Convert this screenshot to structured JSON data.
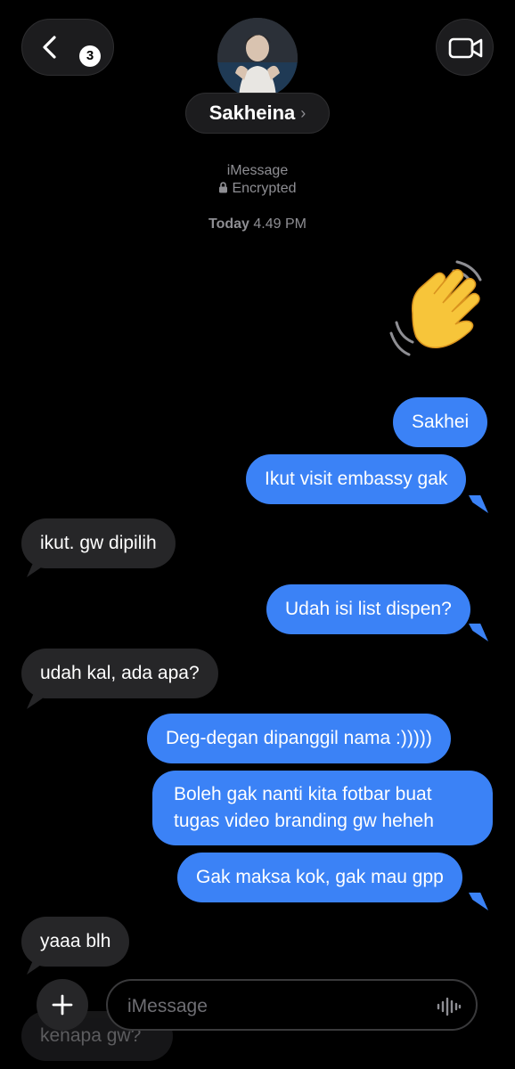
{
  "header": {
    "back_count": "3",
    "contact_name": "Sakheina",
    "name_arrow": "›"
  },
  "meta": {
    "service": "iMessage",
    "encrypted": "Encrypted",
    "timestamp_day": "Today",
    "timestamp_time": "4.49 PM"
  },
  "messages": [
    {
      "sender": "me",
      "text": "Sakhei"
    },
    {
      "sender": "me",
      "text": "Ikut visit embassy gak"
    },
    {
      "sender": "them",
      "text": "ikut. gw dipilih"
    },
    {
      "sender": "me",
      "text": "Udah isi list dispen?"
    },
    {
      "sender": "them",
      "text": "udah kal, ada apa?"
    },
    {
      "sender": "me",
      "text": "Deg-degan dipanggil nama :)))))"
    },
    {
      "sender": "me",
      "text": "Boleh gak nanti kita fotbar buat tugas video branding gw heheh"
    },
    {
      "sender": "me",
      "text": "Gak maksa kok, gak mau gpp"
    },
    {
      "sender": "them",
      "text": "yaaa blh"
    },
    {
      "sender": "them",
      "text": "kenapa gw?"
    }
  ],
  "composer": {
    "placeholder": "iMessage"
  },
  "icons": {
    "back": "chevron-left-icon",
    "video": "video-camera-icon",
    "add": "plus-icon",
    "audio": "waveform-icon",
    "lock": "lock-icon",
    "wave": "waving-hand-emoji"
  },
  "colors": {
    "outgoing_bubble": "#3b82f6",
    "incoming_bubble": "#262628",
    "background": "#000000"
  }
}
